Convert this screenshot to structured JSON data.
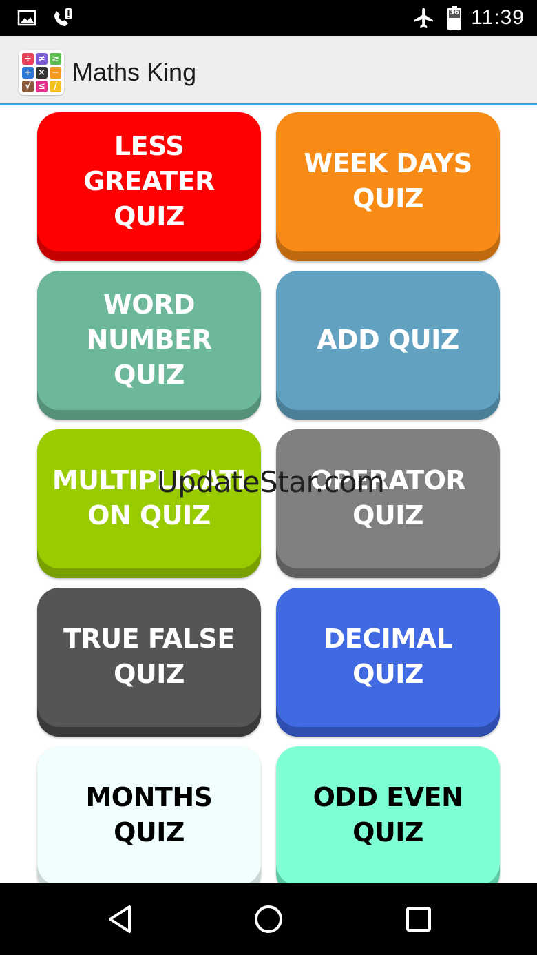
{
  "status_bar": {
    "time": "11:39",
    "battery_level": "36",
    "icons": [
      "image-notification-icon",
      "missed-call-icon",
      "airplane-mode-icon",
      "battery-icon"
    ]
  },
  "app_bar": {
    "title": "Maths King",
    "logo_symbols": [
      "÷",
      "≠",
      "≥",
      "+",
      "×",
      "−",
      "√",
      "≤",
      "/"
    ],
    "logo_colors": [
      "#e8425a",
      "#7c5cd6",
      "#5bbd4e",
      "#2f78d8",
      "#333333",
      "#f39a1f",
      "#8a5a3c",
      "#e0308a",
      "#f2c21a"
    ]
  },
  "quizzes": [
    {
      "label": "LESS\nGREATER\nQUIZ",
      "color": "#ff0000",
      "shade": "#c40000",
      "text_color": "#ffffff"
    },
    {
      "label": "WEEK DAYS\nQUIZ",
      "color": "#f78b16",
      "shade": "#c06a10",
      "text_color": "#ffffff"
    },
    {
      "label": "WORD\nNUMBER\nQUIZ",
      "color": "#6db89a",
      "shade": "#559078",
      "text_color": "#ffffff"
    },
    {
      "label": "ADD QUIZ",
      "color": "#62a2c0",
      "shade": "#4b7f98",
      "text_color": "#ffffff"
    },
    {
      "label": "MULTIPLICATI\nON QUIZ",
      "color": "#99cc00",
      "shade": "#77a000",
      "text_color": "#ffffff"
    },
    {
      "label": "OPERATOR\nQUIZ",
      "color": "#808080",
      "shade": "#5f5f5f",
      "text_color": "#ffffff"
    },
    {
      "label": "TRUE FALSE\nQUIZ",
      "color": "#555555",
      "shade": "#3a3a3a",
      "text_color": "#ffffff"
    },
    {
      "label": "DECIMAL\nQUIZ",
      "color": "#4169e1",
      "shade": "#2f4fb0",
      "text_color": "#ffffff"
    },
    {
      "label": "MONTHS\nQUIZ",
      "color": "#f0fffe",
      "shade": "#c9d6d5",
      "text_color": "#000000"
    },
    {
      "label": "ODD EVEN\nQUIZ",
      "color": "#7fffd4",
      "shade": "#5fc9a6",
      "text_color": "#000000"
    }
  ],
  "watermark": "UpdateStar.com",
  "nav_bar": {
    "buttons": [
      "back-icon",
      "home-icon",
      "recents-icon"
    ]
  }
}
